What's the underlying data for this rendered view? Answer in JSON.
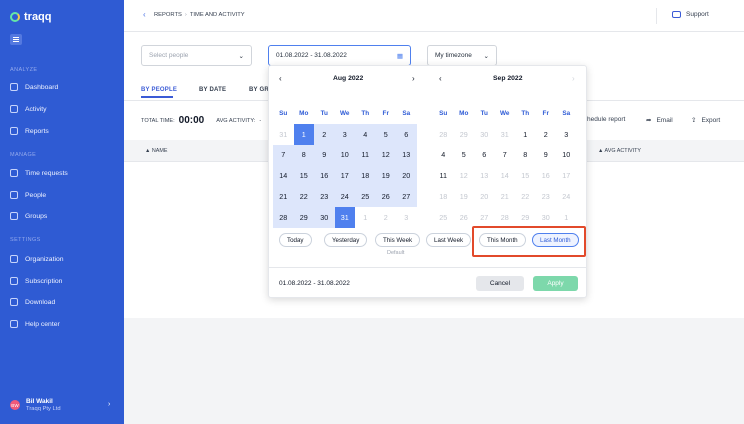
{
  "app": {
    "name": "traqq"
  },
  "sidebar": {
    "sections": {
      "analyze": "ANALYZE",
      "manage": "MANAGE",
      "settings": "SETTINGS"
    },
    "items": [
      {
        "label": "Dashboard",
        "icon": "home-icon"
      },
      {
        "label": "Activity",
        "icon": "activity-icon"
      },
      {
        "label": "Reports",
        "icon": "reports-icon"
      },
      {
        "label": "Time requests",
        "icon": "clock-icon"
      },
      {
        "label": "People",
        "icon": "people-icon"
      },
      {
        "label": "Groups",
        "icon": "groups-icon"
      },
      {
        "label": "Organization",
        "icon": "organization-icon"
      },
      {
        "label": "Subscription",
        "icon": "star-icon"
      },
      {
        "label": "Download",
        "icon": "download-icon"
      },
      {
        "label": "Help center",
        "icon": "help-icon"
      }
    ],
    "user": {
      "initials": "BW",
      "name": "Bil Wakil",
      "company": "Traqq Pty Ltd"
    }
  },
  "header": {
    "breadcrumb": [
      "REPORTS",
      "TIME AND ACTIVITY"
    ],
    "support": "Support"
  },
  "filters": {
    "people_placeholder": "Select people",
    "date_range": "01.08.2022 - 31.08.2022",
    "timezone": "My timezone"
  },
  "tabs": [
    "BY PEOPLE",
    "BY DATE",
    "BY GR"
  ],
  "stats": {
    "total_time_label": "TOTAL TIME:",
    "total_time": "00:00",
    "avg_activity_label": "AVG ACTIVITY:",
    "avg_activity": "-"
  },
  "actions": {
    "schedule": "hedule report",
    "email": "Email",
    "export": "Export"
  },
  "table": {
    "col_name": "NAME",
    "col_avg": "AVG ACTIVITY"
  },
  "datepicker": {
    "weekdays": [
      "Su",
      "Mo",
      "Tu",
      "We",
      "Th",
      "Fr",
      "Sa"
    ],
    "months": [
      {
        "title": "Aug 2022",
        "days": [
          "31",
          "1",
          "2",
          "3",
          "4",
          "5",
          "6",
          "7",
          "8",
          "9",
          "10",
          "11",
          "12",
          "13",
          "14",
          "15",
          "16",
          "17",
          "18",
          "19",
          "20",
          "21",
          "22",
          "23",
          "24",
          "25",
          "26",
          "27",
          "28",
          "29",
          "30",
          "31",
          "1",
          "2",
          "3"
        ]
      },
      {
        "title": "Sep 2022",
        "days": [
          "28",
          "29",
          "30",
          "31",
          "1",
          "2",
          "3",
          "4",
          "5",
          "6",
          "7",
          "8",
          "9",
          "10",
          "11",
          "12",
          "13",
          "14",
          "15",
          "16",
          "17",
          "18",
          "19",
          "20",
          "21",
          "22",
          "23",
          "24",
          "25",
          "26",
          "27",
          "28",
          "29",
          "30",
          "1"
        ]
      }
    ],
    "quick": [
      "Today",
      "Yesterday",
      "This Week",
      "Last Week",
      "This Month",
      "Last Month"
    ],
    "default_label": "Default",
    "range_text": "01.08.2022  -  31.08.2022",
    "cancel": "Cancel",
    "apply": "Apply"
  }
}
